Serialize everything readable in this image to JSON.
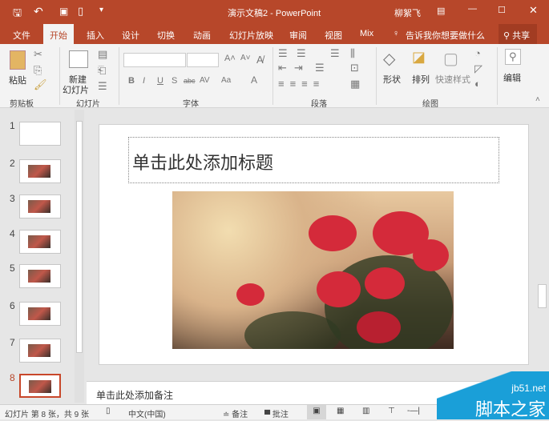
{
  "titlebar": {
    "title": "演示文稿2 - PowerPoint",
    "user": "柳絮飞",
    "icons": [
      "save-icon",
      "undo-icon",
      "present-icon",
      "new-icon",
      "customize-icon"
    ]
  },
  "tabs": [
    "文件",
    "开始",
    "插入",
    "设计",
    "切换",
    "动画",
    "幻灯片放映",
    "审阅",
    "视图",
    "Mix"
  ],
  "tellme": "告诉我你想要做什么",
  "share": "共享",
  "ribbon": {
    "paste": "粘贴",
    "clipboard": "剪贴板",
    "new_slide_1": "新建",
    "new_slide_2": "幻灯片",
    "slides": "幻灯片",
    "font": "字体",
    "paragraph": "段落",
    "shape": "形状",
    "arrange": "排列",
    "quick_style": "快速样式",
    "drawing": "绘图",
    "edit": "编辑",
    "font_buttons": [
      "B",
      "I",
      "U",
      "S",
      "abc",
      "AV",
      "Aa",
      "A"
    ]
  },
  "thumbnails": [
    "1",
    "2",
    "3",
    "4",
    "5",
    "6",
    "7",
    "8"
  ],
  "selected_slide": 8,
  "slide": {
    "title_placeholder": "单击此处添加标题"
  },
  "notes": "单击此处添加备注",
  "status": {
    "slide_info": "幻灯片 第 8 张，共 9 张",
    "language": "中文(中国)",
    "notes": "备注",
    "comments": "批注"
  },
  "watermark": {
    "url": "jb51.net",
    "name": "脚本之家"
  },
  "colors": {
    "accent": "#b7472a"
  }
}
